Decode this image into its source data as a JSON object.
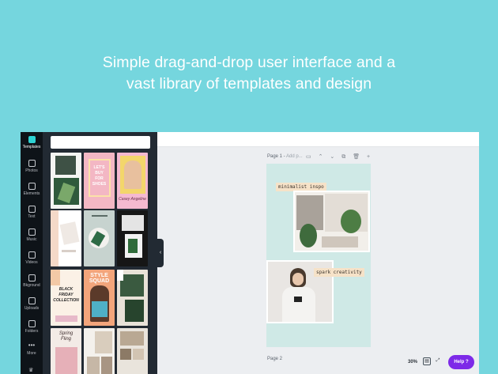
{
  "headline": {
    "line1": "Simple drag-and-drop user interface and a",
    "line2": "vast library of templates and design"
  },
  "sidebar": {
    "items": [
      {
        "label": "Templates",
        "icon": "templates-icon",
        "active": true
      },
      {
        "label": "Photos",
        "icon": "photos-icon"
      },
      {
        "label": "Elements",
        "icon": "elements-icon"
      },
      {
        "label": "Text",
        "icon": "text-icon"
      },
      {
        "label": "Music",
        "icon": "music-icon"
      },
      {
        "label": "Videos",
        "icon": "videos-icon"
      },
      {
        "label": "Bkground",
        "icon": "background-icon"
      },
      {
        "label": "Uploads",
        "icon": "uploads-icon"
      },
      {
        "label": "Folders",
        "icon": "folders-icon"
      },
      {
        "label": "More",
        "icon": "more-icon"
      }
    ]
  },
  "search": {
    "placeholder": ""
  },
  "templates": {
    "t2": "LET'S\nBUY\nFOR\nSHOES",
    "t3": "Casey Angeline",
    "t8": "BLACK\nFRIDAY\nCOLLECTION",
    "t9": "STYLE\nSQUAD",
    "t11": "Spring\nFling"
  },
  "canvas": {
    "page1_title": "Page 1 - ",
    "page1_add": "Add p...",
    "tools": [
      "comment-icon",
      "chevron-up-icon",
      "chevron-down-icon",
      "duplicate-icon",
      "trash-icon",
      "add-page-icon"
    ],
    "chip1": "minimalist inspo",
    "chip2": "spark creativity",
    "page2_title": "Page 2"
  },
  "footer": {
    "zoom": "30%",
    "help_label": "Help ?"
  },
  "colors": {
    "background": "#75d6de",
    "rail": "#0e1318",
    "panel": "#222a33",
    "accent": "#2ed3d3",
    "help": "#7d2ae8"
  }
}
